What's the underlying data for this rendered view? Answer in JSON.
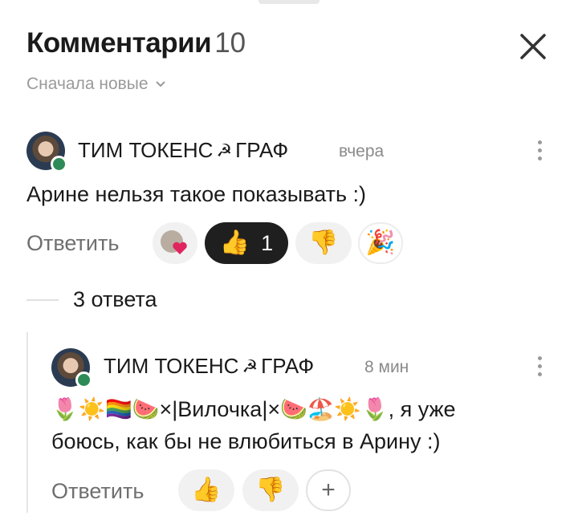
{
  "header": {
    "title": "Комментарии",
    "count": "10"
  },
  "sort": {
    "label": "Сначала новые"
  },
  "comment": {
    "author": "ТИМ ТОКЕНС",
    "author_mark": "☭",
    "author_suffix": "ГРАФ",
    "time": "вчера",
    "text": "Арине нельзя такое показывать :)",
    "reply_label": "Ответить",
    "reactions": [
      {
        "icon": "heart-photo",
        "count": ""
      },
      {
        "icon": "thumbs-up",
        "emoji": "👍",
        "count": "1",
        "active": true
      },
      {
        "icon": "thumbs-down",
        "emoji": "👎",
        "count": ""
      },
      {
        "icon": "party-popper",
        "emoji": "🎉",
        "count": ""
      }
    ]
  },
  "replies": {
    "label": "3 ответа"
  },
  "reply": {
    "author": "ТИМ ТОКЕНС",
    "author_mark": "☭",
    "author_suffix": "ГРАФ",
    "time": "8 мин",
    "line1": "🌷☀️🏳️‍🌈🍉×|Вилочка|×🍉🏖️☀️🌷, я уже",
    "line2": "боюсь, как бы не влюбиться в Арину :)",
    "reply_label": "Ответить",
    "reactions": [
      {
        "icon": "thumbs-up",
        "emoji": "👍"
      },
      {
        "icon": "thumbs-down",
        "emoji": "👎"
      },
      {
        "icon": "add-reaction",
        "emoji": "+"
      }
    ]
  },
  "colors": {
    "online": "#2e8b57",
    "active_chip": "#1f1f1f",
    "chip": "#f1f1f1"
  }
}
